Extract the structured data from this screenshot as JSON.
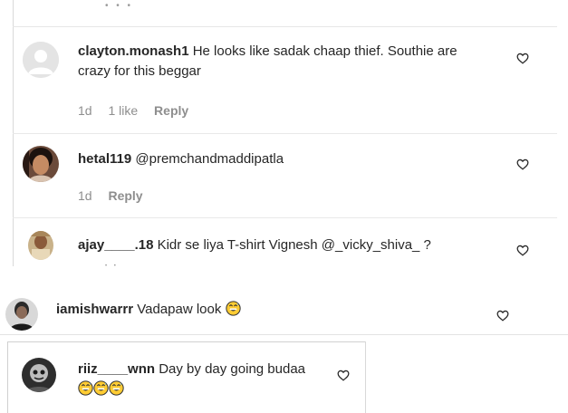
{
  "comments": [
    {
      "username": "clayton.monash1",
      "text_line1": "He looks like sadak chaap thief. Southie are",
      "text_line2": "crazy for this beggar",
      "time": "1d",
      "likes": "1 like",
      "reply_label": "Reply"
    },
    {
      "username": "hetal119",
      "text": "@premchandmaddipatla",
      "time": "1d",
      "reply_label": "Reply"
    },
    {
      "username": "ajay____.18",
      "text": "Kidr se liya T-shirt Vignesh @_vicky_shiva_ ?"
    },
    {
      "username": "iamishwarrr",
      "text": "Vadapaw look",
      "emoji": "grinning-sweat-emoji"
    },
    {
      "username": "riiz____wnn",
      "text": "Day by day going budaa",
      "emoji_count": 3,
      "emoji": "grinning-sweat-emoji"
    }
  ],
  "icons": {
    "like": "heart-outline-icon",
    "more": "ellipsis-dots-icon",
    "default_avatar": "default-avatar-icon"
  },
  "colors": {
    "text": "#262626",
    "meta": "#8e8e8e",
    "divider": "#dbdbdb"
  }
}
